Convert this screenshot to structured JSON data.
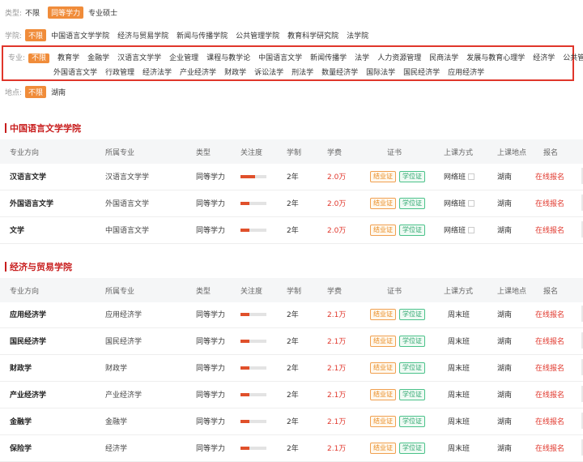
{
  "filters": {
    "type": {
      "label": "类型:",
      "options": [
        "不限",
        "同等学力",
        "专业硕士"
      ]
    },
    "college": {
      "label": "学院:",
      "options": [
        "不限",
        "中国语言文学学院",
        "经济与贸易学院",
        "新闻与传播学院",
        "公共管理学院",
        "教育科学研究院",
        "法学院"
      ]
    },
    "major": {
      "label": "专业:",
      "line1": [
        "不限",
        "教育学",
        "金融学",
        "汉语言文学学",
        "企业管理",
        "课程与教学论",
        "中国语言文学",
        "新闻传播学",
        "法学",
        "人力资源管理",
        "民商法学",
        "发展与教育心理学",
        "经济学",
        "公共管理"
      ],
      "line2": [
        "外国语言文学",
        "行政管理",
        "经济法学",
        "产业经济学",
        "财政学",
        "诉讼法学",
        "刑法学",
        "数量经济学",
        "国际法学",
        "国民经济学",
        "应用经济学"
      ]
    },
    "place": {
      "label": "地点:",
      "options": [
        "不限",
        "湖南"
      ]
    }
  },
  "headers": {
    "dir": "专业方向",
    "maj": "所属专业",
    "type": "类型",
    "att": "关注度",
    "dur": "学制",
    "fee": "学费",
    "cert": "证书",
    "mode": "上课方式",
    "place": "上课地点",
    "apply": "报名"
  },
  "sections": [
    {
      "title": "中国语言文学学院",
      "rows": [
        {
          "dir": "汉语言文学",
          "maj": "汉语言文学学",
          "type": "同等学力",
          "attention": 0.55,
          "dur": "2年",
          "fee": "2.0万",
          "cert1": "结业证",
          "cert2": "学位证",
          "mode": "网络班",
          "place": "湖南",
          "apply": "在线报名"
        },
        {
          "dir": "外国语言文学",
          "maj": "外国语言文学",
          "type": "同等学力",
          "attention": 0.35,
          "dur": "2年",
          "fee": "2.0万",
          "cert1": "结业证",
          "cert2": "学位证",
          "mode": "网络班",
          "place": "湖南",
          "apply": "在线报名"
        },
        {
          "dir": "文学",
          "maj": "中国语言文学",
          "type": "同等学力",
          "attention": 0.35,
          "dur": "2年",
          "fee": "2.0万",
          "cert1": "结业证",
          "cert2": "学位证",
          "mode": "网络班",
          "place": "湖南",
          "apply": "在线报名"
        }
      ]
    },
    {
      "title": "经济与贸易学院",
      "rows": [
        {
          "dir": "应用经济学",
          "maj": "应用经济学",
          "type": "同等学力",
          "attention": 0.35,
          "dur": "2年",
          "fee": "2.1万",
          "cert1": "结业证",
          "cert2": "学位证",
          "mode": "周末班",
          "place": "湖南",
          "apply": "在线报名"
        },
        {
          "dir": "国民经济学",
          "maj": "国民经济学",
          "type": "同等学力",
          "attention": 0.35,
          "dur": "2年",
          "fee": "2.1万",
          "cert1": "结业证",
          "cert2": "学位证",
          "mode": "周末班",
          "place": "湖南",
          "apply": "在线报名"
        },
        {
          "dir": "财政学",
          "maj": "财政学",
          "type": "同等学力",
          "attention": 0.35,
          "dur": "2年",
          "fee": "2.1万",
          "cert1": "结业证",
          "cert2": "学位证",
          "mode": "周末班",
          "place": "湖南",
          "apply": "在线报名"
        },
        {
          "dir": "产业经济学",
          "maj": "产业经济学",
          "type": "同等学力",
          "attention": 0.35,
          "dur": "2年",
          "fee": "2.1万",
          "cert1": "结业证",
          "cert2": "学位证",
          "mode": "周末班",
          "place": "湖南",
          "apply": "在线报名"
        },
        {
          "dir": "金融学",
          "maj": "金融学",
          "type": "同等学力",
          "attention": 0.35,
          "dur": "2年",
          "fee": "2.1万",
          "cert1": "结业证",
          "cert2": "学位证",
          "mode": "周末班",
          "place": "湖南",
          "apply": "在线报名"
        },
        {
          "dir": "保险学",
          "maj": "经济学",
          "type": "同等学力",
          "attention": 0.35,
          "dur": "2年",
          "fee": "2.1万",
          "cert1": "结业证",
          "cert2": "学位证",
          "mode": "周末班",
          "place": "湖南",
          "apply": "在线报名"
        }
      ]
    }
  ]
}
